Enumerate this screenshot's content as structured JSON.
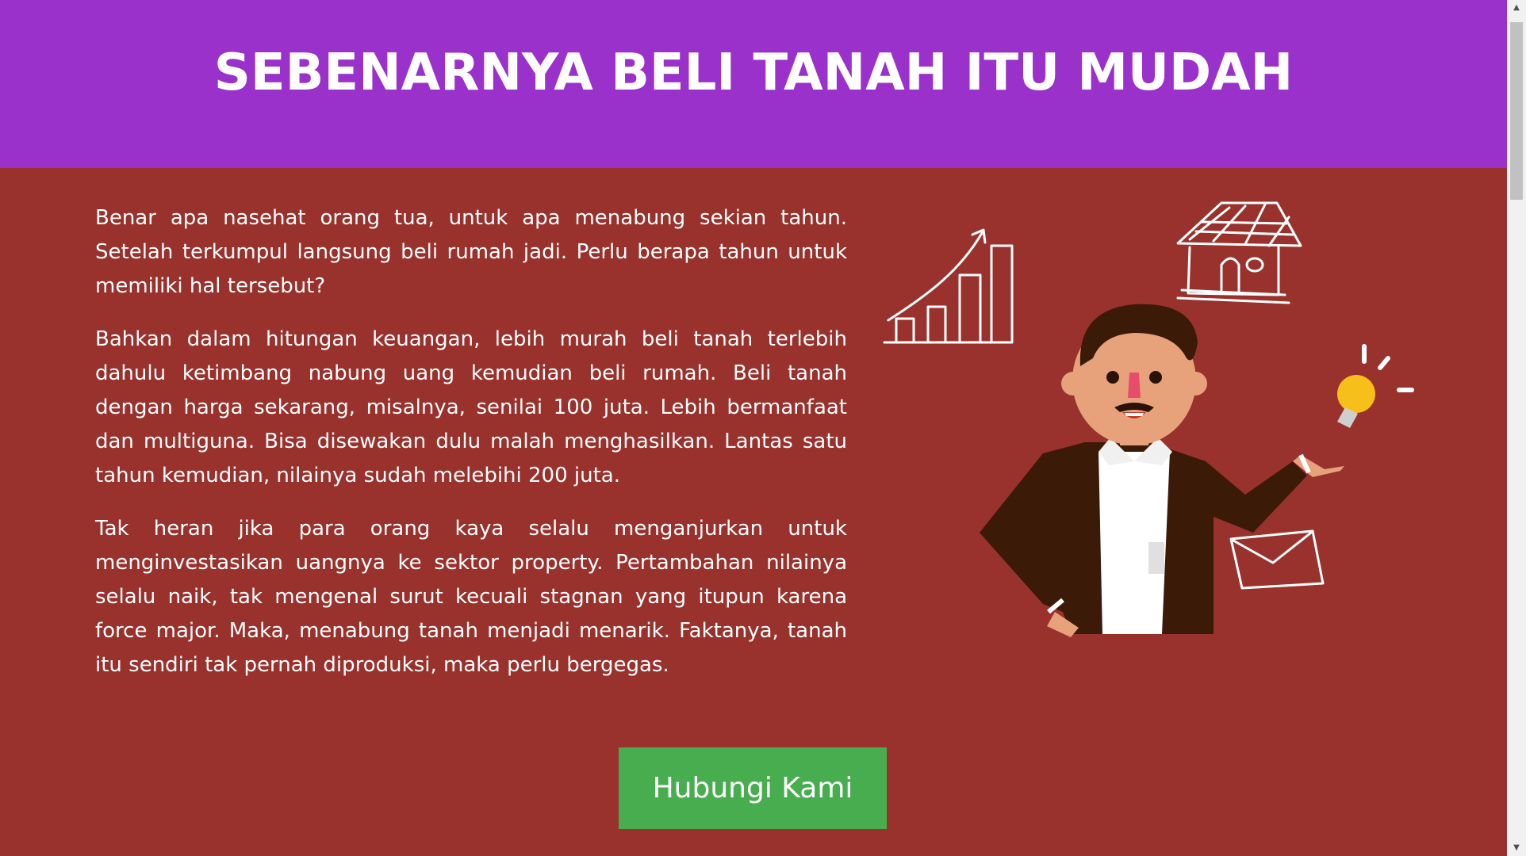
{
  "header": {
    "title": "SEBENARNYA BELI TANAH ITU MUDAH"
  },
  "main": {
    "paragraphs": [
      "Benar apa nasehat orang tua, untuk apa menabung sekian tahun. Setelah terkumpul langsung beli rumah jadi. Perlu berapa tahun untuk memiliki hal tersebut?",
      "Bahkan dalam hitungan keuangan, lebih murah beli tanah terlebih dahulu ketimbang nabung uang kemudian beli rumah. Beli tanah dengan harga sekarang, misalnya, senilai 100 juta. Lebih bermanfaat dan multiguna. Bisa disewakan dulu malah menghasilkan. Lantas satu tahun kemudian, nilainya sudah melebihi 200 juta.",
      "Tak heran jika para orang kaya selalu menganjurkan untuk menginvestasikan uangnya ke sektor property. Pertambahan nilainya selalu naik, tak mengenal surut kecuali stagnan yang itupun karena force major. Maka, menabung tanah menjadi menarik. Faktanya, tanah itu sendiri tak pernah diproduksi, maka perlu bergegas."
    ],
    "illustration_icons": [
      "growth-chart-icon",
      "house-icon",
      "lightbulb-icon",
      "envelope-icon",
      "businessman-figure"
    ]
  },
  "cta": {
    "label": "Hubungi Kami"
  },
  "colors": {
    "header_bg": "#9b31cb",
    "content_bg": "#99312c",
    "cta_bg": "#48ad4f",
    "text": "#ffffff"
  }
}
